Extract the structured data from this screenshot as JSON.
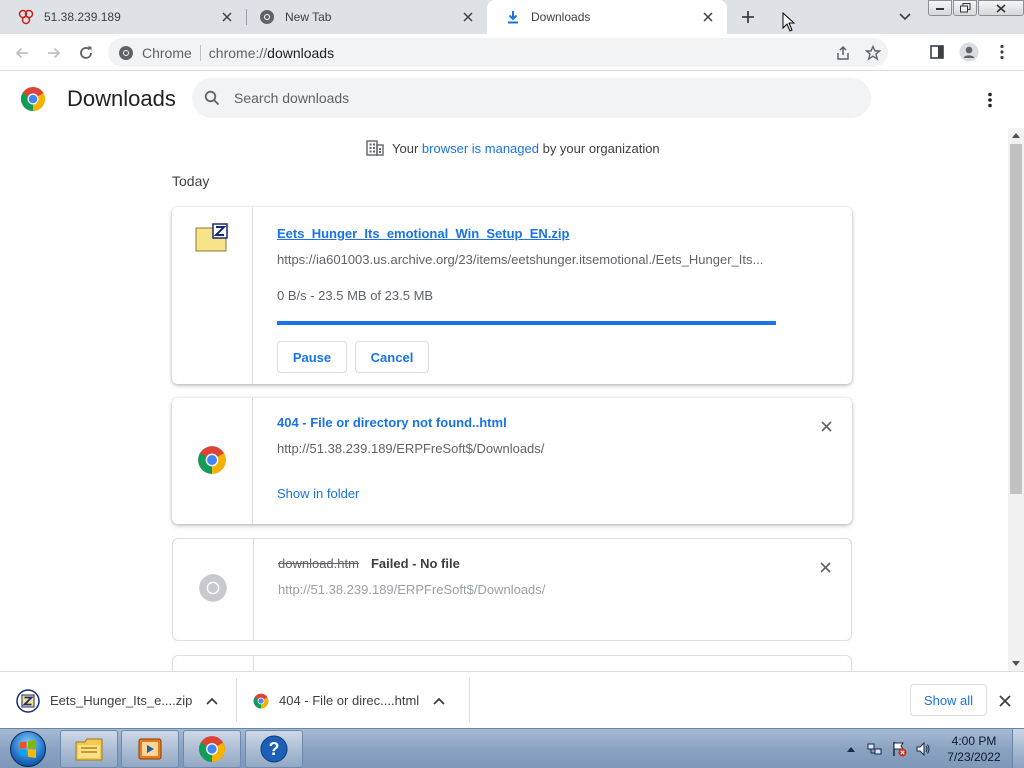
{
  "tabs": [
    {
      "title": "51.38.239.189",
      "icon": "network-icon"
    },
    {
      "title": "New Tab",
      "icon": "chrome-gray-icon"
    },
    {
      "title": "Downloads",
      "icon": "download-icon",
      "active": true
    }
  ],
  "toolbar": {
    "chip_label": "Chrome",
    "url_scheme": "chrome://",
    "url_path": "downloads"
  },
  "page": {
    "title": "Downloads",
    "search_placeholder": "Search downloads",
    "managed_prefix": "Your ",
    "managed_link": "browser is managed",
    "managed_suffix": " by your organization",
    "date_group": "Today"
  },
  "downloads": [
    {
      "filename": "Eets_Hunger_Its_emotional_Win_Setup_EN.zip",
      "url": "https://ia601003.us.archive.org/23/items/eetshunger.itsemotional./Eets_Hunger_Its...",
      "status": "0 B/s - 23.5 MB of 23.5 MB",
      "progress": 1.0,
      "pause_label": "Pause",
      "cancel_label": "Cancel"
    },
    {
      "filename": "404 - File or directory not found..html",
      "url": "http://51.38.239.189/ERPFreSoft$/Downloads/",
      "action_label": "Show in folder"
    },
    {
      "filename": "download.htm",
      "failed_label": "Failed - No file",
      "url": "http://51.38.239.189/ERPFreSoft$/Downloads/"
    }
  ],
  "shelf": {
    "items": [
      {
        "label": "Eets_Hunger_Its_e....zip"
      },
      {
        "label": "404 - File or direc....html"
      }
    ],
    "show_all_label": "Show all"
  },
  "taskbar": {
    "time": "4:00 PM",
    "date": "7/23/2022"
  },
  "colors": {
    "accent": "#1a73e8",
    "tabstrip": "#dee1e6"
  }
}
